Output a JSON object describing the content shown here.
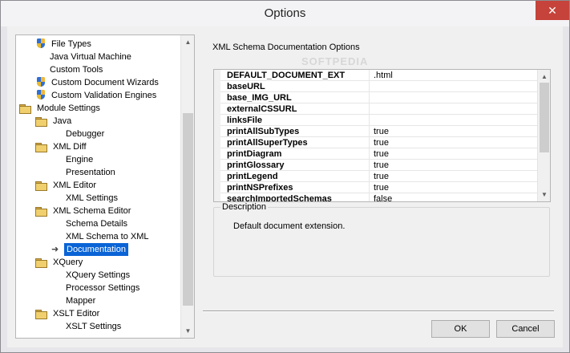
{
  "window": {
    "title": "Options",
    "close_glyph": "✕"
  },
  "tree": {
    "items": [
      {
        "label": "File Types",
        "icon": "shield-icon",
        "indent": 2
      },
      {
        "label": "Java Virtual Machine",
        "icon": "",
        "indent": 2
      },
      {
        "label": "Custom Tools",
        "icon": "",
        "indent": 2
      },
      {
        "label": "Custom Document Wizards",
        "icon": "shield-icon",
        "indent": 2
      },
      {
        "label": "Custom Validation Engines",
        "icon": "shield-icon",
        "indent": 2
      },
      {
        "label": "Module Settings",
        "icon": "folder-icon",
        "indent": 1
      },
      {
        "label": "Java",
        "icon": "folder-icon",
        "indent": 2
      },
      {
        "label": "Debugger",
        "icon": "",
        "indent": 3
      },
      {
        "label": "XML Diff",
        "icon": "folder-icon",
        "indent": 2
      },
      {
        "label": "Engine",
        "icon": "",
        "indent": 3
      },
      {
        "label": "Presentation",
        "icon": "",
        "indent": 3
      },
      {
        "label": "XML Editor",
        "icon": "folder-icon",
        "indent": 2
      },
      {
        "label": "XML Settings",
        "icon": "",
        "indent": 3
      },
      {
        "label": "XML Schema Editor",
        "icon": "folder-icon",
        "indent": 2
      },
      {
        "label": "Schema Details",
        "icon": "",
        "indent": 3
      },
      {
        "label": "XML Schema to XML",
        "icon": "",
        "indent": 3
      },
      {
        "label": "Documentation",
        "icon": "arrow-icon",
        "indent": 3,
        "selected": true
      },
      {
        "label": "XQuery",
        "icon": "folder-icon",
        "indent": 2
      },
      {
        "label": "XQuery Settings",
        "icon": "",
        "indent": 3
      },
      {
        "label": "Processor Settings",
        "icon": "",
        "indent": 3
      },
      {
        "label": "Mapper",
        "icon": "",
        "indent": 3
      },
      {
        "label": "XSLT Editor",
        "icon": "folder-icon",
        "indent": 2
      },
      {
        "label": "XSLT Settings",
        "icon": "",
        "indent": 3
      }
    ]
  },
  "panel": {
    "title": "XML Schema Documentation Options",
    "watermark": "SOFTPEDIA",
    "properties": [
      {
        "key": "DEFAULT_DOCUMENT_EXT",
        "value": ".html"
      },
      {
        "key": "baseURL",
        "value": ""
      },
      {
        "key": "base_IMG_URL",
        "value": ""
      },
      {
        "key": "externalCSSURL",
        "value": ""
      },
      {
        "key": "linksFile",
        "value": ""
      },
      {
        "key": "printAllSubTypes",
        "value": "true"
      },
      {
        "key": "printAllSuperTypes",
        "value": "true"
      },
      {
        "key": "printDiagram",
        "value": "true"
      },
      {
        "key": "printGlossary",
        "value": "true"
      },
      {
        "key": "printLegend",
        "value": "true"
      },
      {
        "key": "printNSPrefixes",
        "value": "true"
      },
      {
        "key": "searchImportedSchemas",
        "value": "false"
      }
    ],
    "description_label": "Description",
    "description_text": "Default document extension."
  },
  "buttons": {
    "ok": "OK",
    "cancel": "Cancel"
  },
  "colors": {
    "selection": "#0a64d6",
    "close_button": "#c5433b"
  }
}
